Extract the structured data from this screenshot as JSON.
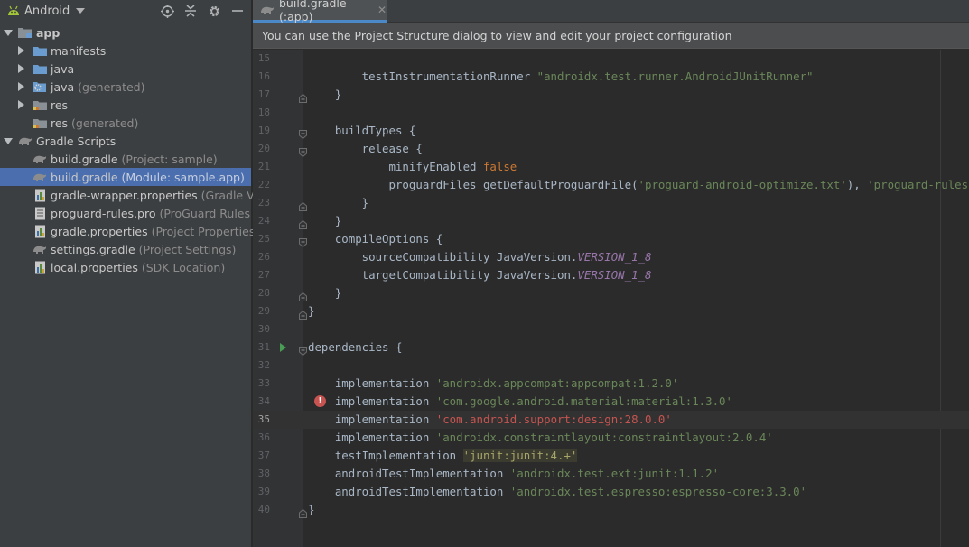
{
  "project_panel": {
    "view_label": "Android",
    "tree": [
      {
        "label": "app",
        "hint": "",
        "icon": "module-folder-icon",
        "expand": "down",
        "depth": 0,
        "bold": true,
        "selected": false
      },
      {
        "label": "manifests",
        "hint": "",
        "icon": "folder-icon",
        "expand": "right",
        "depth": 1,
        "bold": false,
        "selected": false
      },
      {
        "label": "java",
        "hint": "",
        "icon": "folder-icon",
        "expand": "right",
        "depth": 1,
        "bold": false,
        "selected": false
      },
      {
        "label": "java",
        "hint": "(generated)",
        "icon": "generated-folder-icon",
        "expand": "right",
        "depth": 1,
        "bold": false,
        "selected": false
      },
      {
        "label": "res",
        "hint": "",
        "icon": "resource-folder-icon",
        "expand": "right",
        "depth": 1,
        "bold": false,
        "selected": false
      },
      {
        "label": "res",
        "hint": "(generated)",
        "icon": "resource-folder-icon",
        "expand": "none",
        "depth": 1,
        "bold": false,
        "selected": false
      },
      {
        "label": "Gradle Scripts",
        "hint": "",
        "icon": "gradle-icon",
        "expand": "down",
        "depth": 0,
        "bold": false,
        "selected": false
      },
      {
        "label": "build.gradle",
        "hint": "(Project: sample)",
        "icon": "gradle-icon",
        "expand": "none",
        "depth": 1,
        "bold": false,
        "selected": false
      },
      {
        "label": "build.gradle",
        "hint": "(Module: sample.app)",
        "icon": "gradle-icon",
        "expand": "none",
        "depth": 1,
        "bold": false,
        "selected": true
      },
      {
        "label": "gradle-wrapper.properties",
        "hint": "(Gradle Version",
        "icon": "properties-file-icon",
        "expand": "none",
        "depth": 1,
        "bold": false,
        "selected": false
      },
      {
        "label": "proguard-rules.pro",
        "hint": "(ProGuard Rules for sa",
        "icon": "text-file-icon",
        "expand": "none",
        "depth": 1,
        "bold": false,
        "selected": false
      },
      {
        "label": "gradle.properties",
        "hint": "(Project Properties)",
        "icon": "properties-file-icon",
        "expand": "none",
        "depth": 1,
        "bold": false,
        "selected": false
      },
      {
        "label": "settings.gradle",
        "hint": "(Project Settings)",
        "icon": "gradle-icon",
        "expand": "none",
        "depth": 1,
        "bold": false,
        "selected": false
      },
      {
        "label": "local.properties",
        "hint": "(SDK Location)",
        "icon": "properties-file-icon",
        "expand": "none",
        "depth": 1,
        "bold": false,
        "selected": false
      }
    ]
  },
  "editor": {
    "tab_label": "build.gradle (:app)",
    "tab_close": "✕",
    "banner": "You can use the Project Structure dialog to view and edit your project configuration",
    "current_line": 35,
    "lines": [
      {
        "n": 15,
        "fold": "",
        "marker": "",
        "tokens": []
      },
      {
        "n": 16,
        "fold": "",
        "marker": "",
        "tokens": [
          {
            "t": "        testInstrumentationRunner ",
            "c": ""
          },
          {
            "t": "\"androidx.test.runner.AndroidJUnitRunner\"",
            "c": "str"
          }
        ]
      },
      {
        "n": 17,
        "fold": "end",
        "marker": "",
        "tokens": [
          {
            "t": "    }",
            "c": ""
          }
        ]
      },
      {
        "n": 18,
        "fold": "",
        "marker": "",
        "tokens": []
      },
      {
        "n": 19,
        "fold": "start",
        "marker": "",
        "tokens": [
          {
            "t": "    buildTypes {",
            "c": ""
          }
        ]
      },
      {
        "n": 20,
        "fold": "start",
        "marker": "",
        "tokens": [
          {
            "t": "        release {",
            "c": ""
          }
        ]
      },
      {
        "n": 21,
        "fold": "",
        "marker": "",
        "tokens": [
          {
            "t": "            minifyEnabled ",
            "c": ""
          },
          {
            "t": "false",
            "c": "kw"
          }
        ]
      },
      {
        "n": 22,
        "fold": "",
        "marker": "",
        "tokens": [
          {
            "t": "            proguardFiles getDefaultProguardFile(",
            "c": ""
          },
          {
            "t": "'proguard-android-optimize.txt'",
            "c": "str"
          },
          {
            "t": "), ",
            "c": ""
          },
          {
            "t": "'proguard-rules.pro'",
            "c": "str"
          }
        ]
      },
      {
        "n": 23,
        "fold": "end",
        "marker": "",
        "tokens": [
          {
            "t": "        }",
            "c": ""
          }
        ]
      },
      {
        "n": 24,
        "fold": "end",
        "marker": "",
        "tokens": [
          {
            "t": "    }",
            "c": ""
          }
        ]
      },
      {
        "n": 25,
        "fold": "start",
        "marker": "",
        "tokens": [
          {
            "t": "    compileOptions {",
            "c": ""
          }
        ]
      },
      {
        "n": 26,
        "fold": "",
        "marker": "",
        "tokens": [
          {
            "t": "        sourceCompatibility JavaVersion.",
            "c": ""
          },
          {
            "t": "VERSION_1_8",
            "c": "const"
          }
        ]
      },
      {
        "n": 27,
        "fold": "",
        "marker": "",
        "tokens": [
          {
            "t": "        targetCompatibility JavaVersion.",
            "c": ""
          },
          {
            "t": "VERSION_1_8",
            "c": "const"
          }
        ]
      },
      {
        "n": 28,
        "fold": "end",
        "marker": "",
        "tokens": [
          {
            "t": "    }",
            "c": ""
          }
        ]
      },
      {
        "n": 29,
        "fold": "end",
        "marker": "",
        "tokens": [
          {
            "t": "}",
            "c": ""
          }
        ]
      },
      {
        "n": 30,
        "fold": "",
        "marker": "",
        "tokens": []
      },
      {
        "n": 31,
        "fold": "start",
        "marker": "run",
        "tokens": [
          {
            "t": "dependencies {",
            "c": ""
          }
        ]
      },
      {
        "n": 32,
        "fold": "",
        "marker": "",
        "tokens": []
      },
      {
        "n": 33,
        "fold": "",
        "marker": "",
        "tokens": [
          {
            "t": "    implementation ",
            "c": ""
          },
          {
            "t": "'androidx.appcompat:appcompat:1.2.0'",
            "c": "str"
          }
        ]
      },
      {
        "n": 34,
        "fold": "",
        "marker": "error",
        "tokens": [
          {
            "t": "    implementation ",
            "c": ""
          },
          {
            "t": "'com.google.android.material:material:1.3.0'",
            "c": "str"
          }
        ]
      },
      {
        "n": 35,
        "fold": "",
        "marker": "",
        "tokens": [
          {
            "t": "    implementation ",
            "c": ""
          },
          {
            "t": "'com.android.support:design:28.0.0'",
            "c": "str-err"
          }
        ]
      },
      {
        "n": 36,
        "fold": "",
        "marker": "",
        "tokens": [
          {
            "t": "    implementation ",
            "c": ""
          },
          {
            "t": "'androidx.constraintlayout:constraintlayout:2.0.4'",
            "c": "str"
          }
        ]
      },
      {
        "n": 37,
        "fold": "",
        "marker": "",
        "tokens": [
          {
            "t": "    testImplementation ",
            "c": ""
          },
          {
            "t": "'junit:junit:4.+'",
            "c": "str-warn"
          }
        ]
      },
      {
        "n": 38,
        "fold": "",
        "marker": "",
        "tokens": [
          {
            "t": "    androidTestImplementation ",
            "c": ""
          },
          {
            "t": "'androidx.test.ext:junit:1.1.2'",
            "c": "str"
          }
        ]
      },
      {
        "n": 39,
        "fold": "",
        "marker": "",
        "tokens": [
          {
            "t": "    androidTestImplementation ",
            "c": ""
          },
          {
            "t": "'androidx.test.espresso:espresso-core:3.3.0'",
            "c": "str"
          }
        ]
      },
      {
        "n": 40,
        "fold": "end",
        "marker": "",
        "tokens": [
          {
            "t": "}",
            "c": ""
          }
        ]
      }
    ]
  },
  "colors": {
    "selection": "#4b6eaf",
    "keyword": "#cc7832",
    "string": "#6a8759",
    "error_string": "#c75450",
    "constant": "#9876aa",
    "android_green": "#a4c639"
  }
}
